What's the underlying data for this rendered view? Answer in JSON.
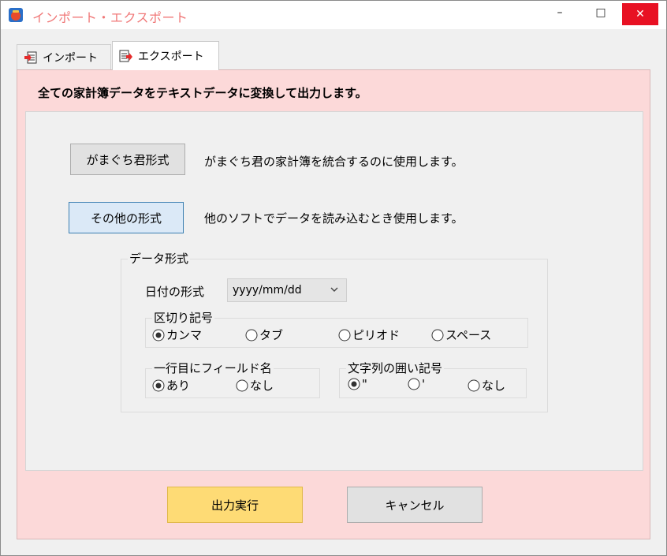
{
  "window": {
    "title": "インポート・エクスポート",
    "controls": {
      "minimize": "–",
      "maximize": "□",
      "close": "✕"
    }
  },
  "tabs": [
    {
      "label": "インポート",
      "icon": "import-document-icon",
      "active": false
    },
    {
      "label": "エクスポート",
      "icon": "export-document-icon",
      "active": true
    }
  ],
  "export": {
    "headline": "全ての家計簿データをテキストデータに変換して出力します。",
    "gamaguchi_button": "がまぐち君形式",
    "gamaguchi_desc": "がまぐち君の家計簿を統合するのに使用します。",
    "other_button": "その他の形式",
    "other_desc": "他のソフトでデータを読み込むとき使用します。",
    "data_format": {
      "title": "データ形式",
      "date_label": "日付の形式",
      "date_value": "yyyy/mm/dd",
      "delimiter": {
        "title": "区切り記号",
        "options": [
          "カンマ",
          "タブ",
          "ピリオド",
          "スペース"
        ],
        "selected": "カンマ"
      },
      "first_row": {
        "title": "一行目にフィールド名",
        "options": [
          "あり",
          "なし"
        ],
        "selected": "あり"
      },
      "quote": {
        "title": "文字列の囲い記号",
        "options": [
          "\"",
          "'",
          "なし"
        ],
        "selected": "\""
      }
    },
    "run_button": "出力実行",
    "cancel_button": "キャンセル"
  },
  "colors": {
    "title_text": "#f07878",
    "panel_bg": "#fcd9d9",
    "run_button": "#fedb75",
    "close_button": "#e81123"
  }
}
